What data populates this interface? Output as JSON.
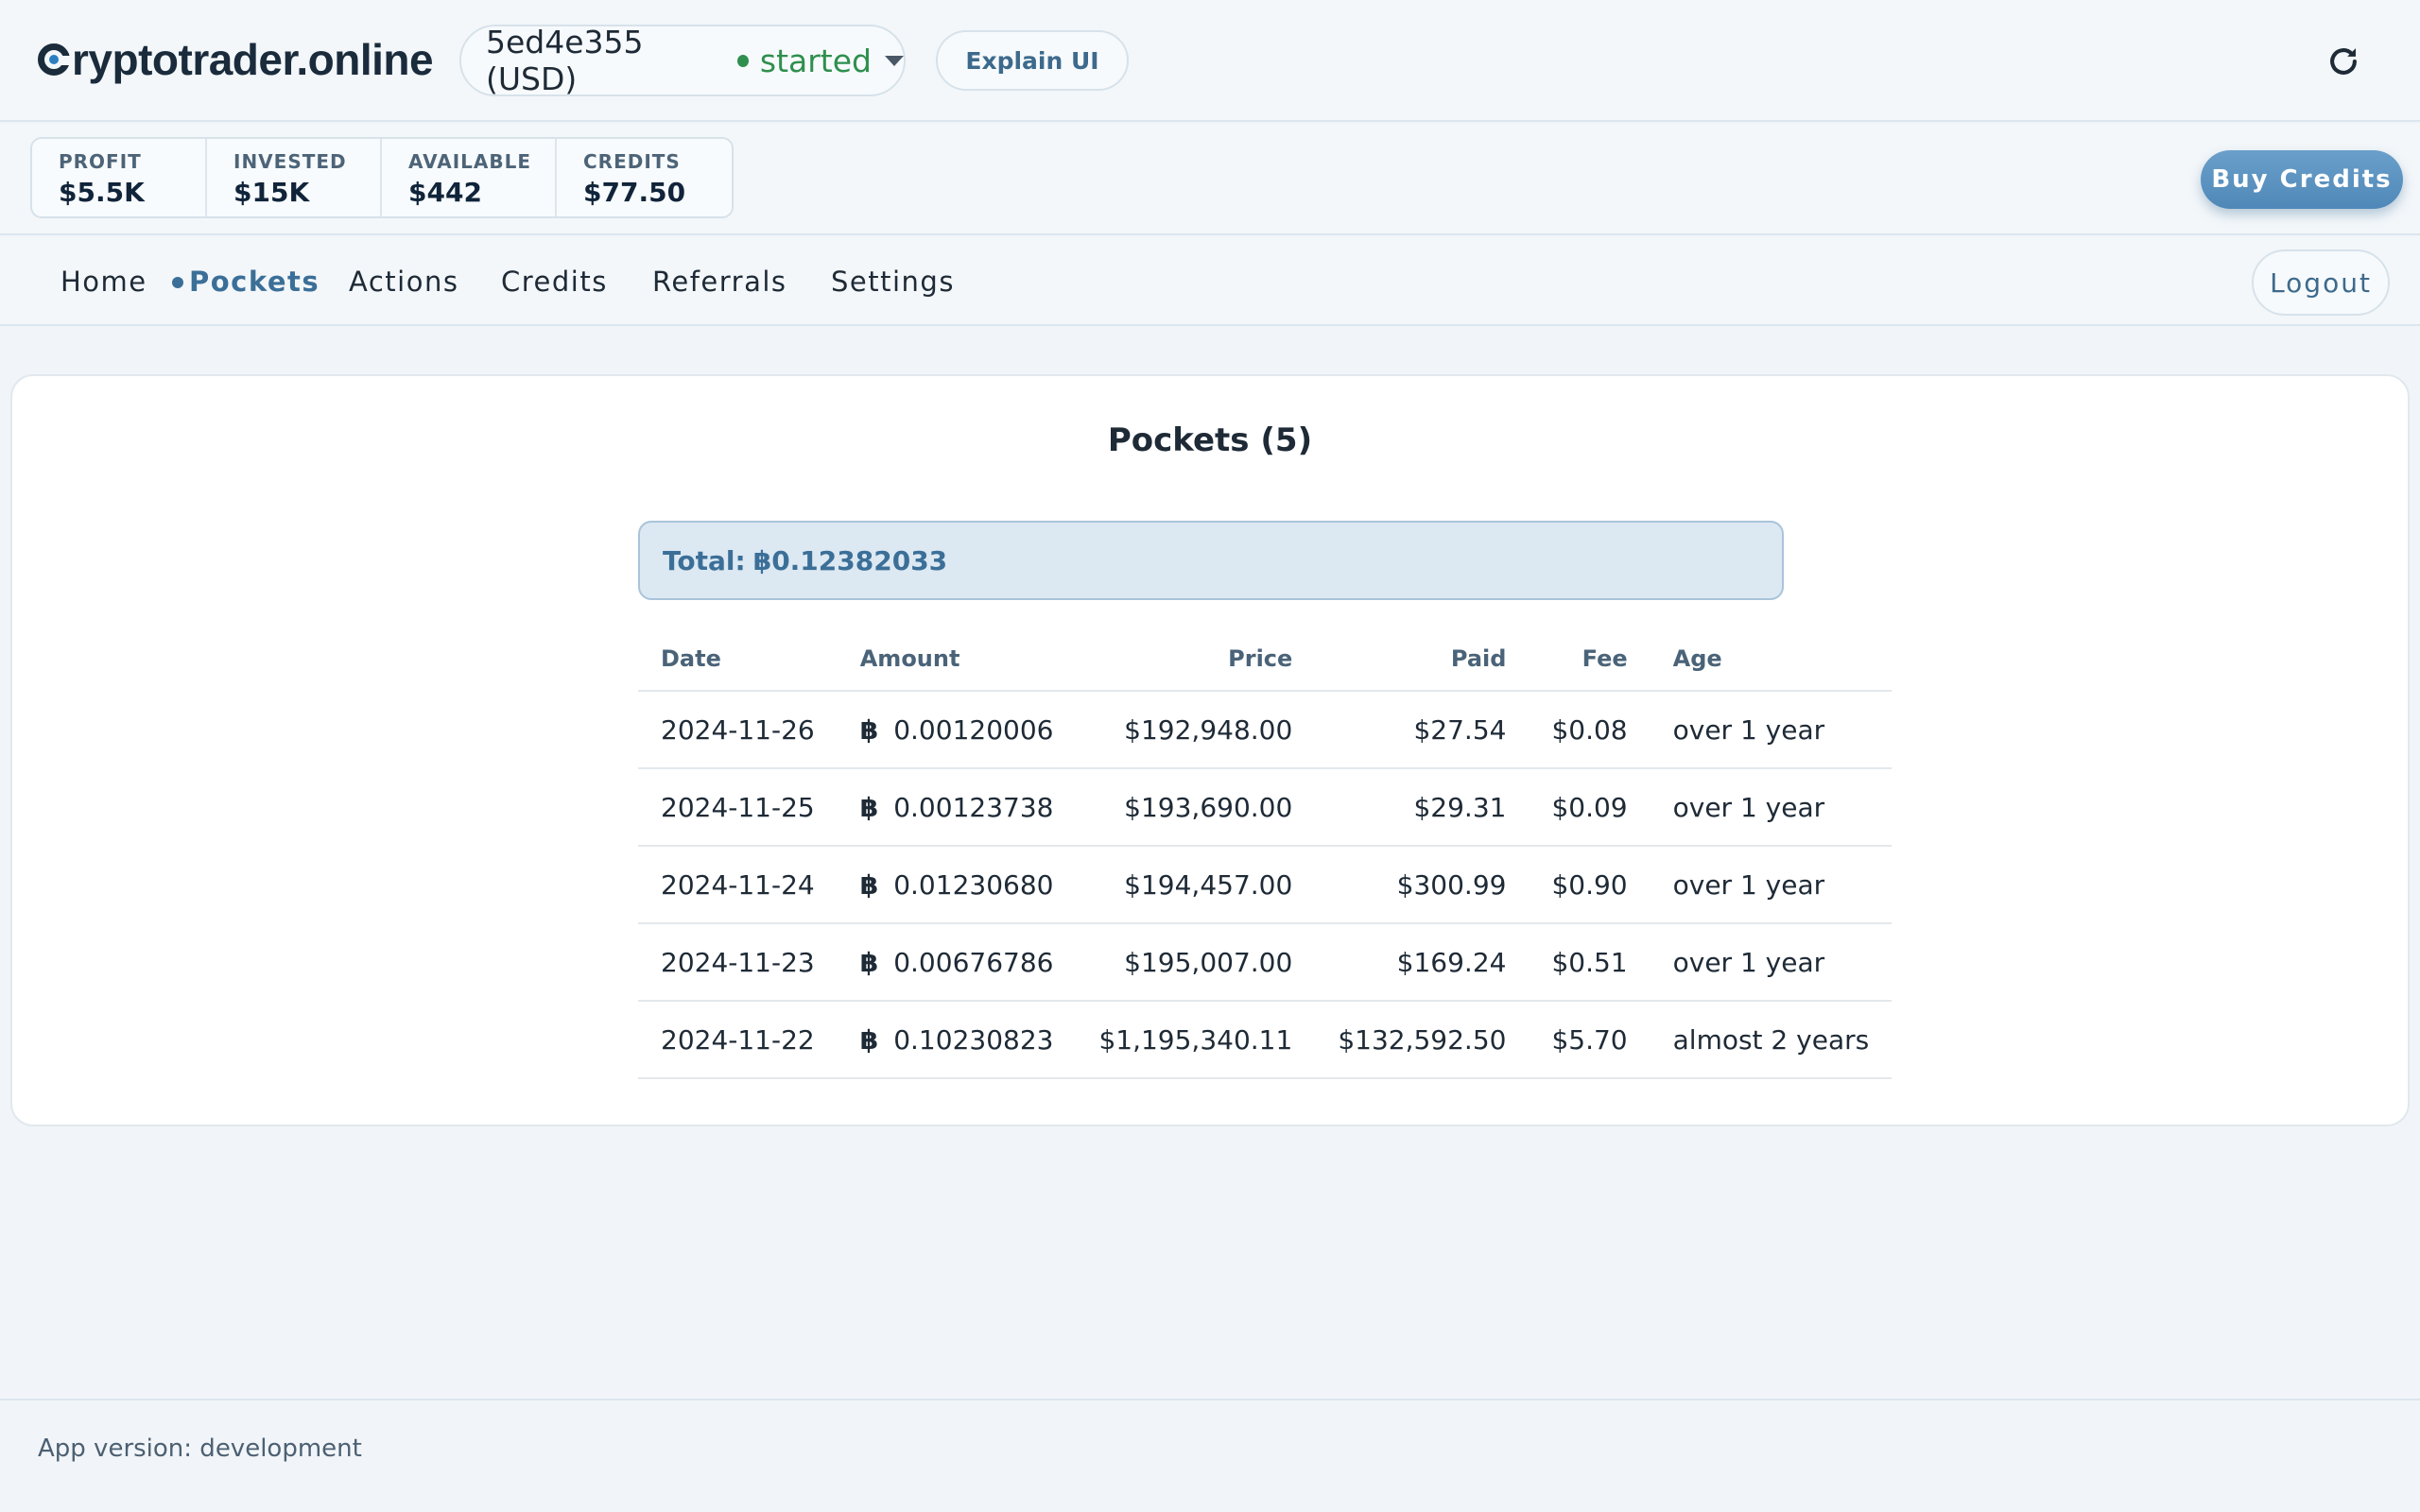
{
  "header": {
    "logo_text": "ryptotrader.online",
    "bot_id": "5ed4e355 (USD)",
    "bot_status": "started",
    "explain_label": "Explain UI",
    "status_color": "#2f8f4e"
  },
  "stats": [
    {
      "label": "PROFIT",
      "value": "$5.5K"
    },
    {
      "label": "INVESTED",
      "value": "$15K"
    },
    {
      "label": "AVAILABLE",
      "value": "$442"
    },
    {
      "label": "CREDITS",
      "value": "$77.50"
    }
  ],
  "buy_credits_label": "Buy Credits",
  "nav": {
    "items": [
      {
        "label": "Home"
      },
      {
        "label": "Pockets"
      },
      {
        "label": "Actions"
      },
      {
        "label": "Credits"
      },
      {
        "label": "Referrals"
      },
      {
        "label": "Settings"
      }
    ],
    "active": "Pockets",
    "logout_label": "Logout"
  },
  "pockets": {
    "title": "Pockets (5)",
    "total_label": "Total:",
    "total_symbol": "฿",
    "total_value": "0.12382033",
    "columns": [
      "Date",
      "Amount",
      "Price",
      "Paid",
      "Fee",
      "Age"
    ],
    "rows": [
      {
        "date": "2024-11-26",
        "symbol": "฿",
        "amount": "0.00120006",
        "price": "$192,948.00",
        "paid": "$27.54",
        "fee": "$0.08",
        "age": "over 1 year"
      },
      {
        "date": "2024-11-25",
        "symbol": "฿",
        "amount": "0.00123738",
        "price": "$193,690.00",
        "paid": "$29.31",
        "fee": "$0.09",
        "age": "over 1 year"
      },
      {
        "date": "2024-11-24",
        "symbol": "฿",
        "amount": "0.01230680",
        "price": "$194,457.00",
        "paid": "$300.99",
        "fee": "$0.90",
        "age": "over 1 year"
      },
      {
        "date": "2024-11-23",
        "symbol": "฿",
        "amount": "0.00676786",
        "price": "$195,007.00",
        "paid": "$169.24",
        "fee": "$0.51",
        "age": "over 1 year"
      },
      {
        "date": "2024-11-22",
        "symbol": "฿",
        "amount": "0.10230823",
        "price": "$1,195,340.11",
        "paid": "$132,592.50",
        "fee": "$5.70",
        "age": "almost 2 years"
      }
    ]
  },
  "footer": {
    "version_text": "App version: development"
  },
  "colors": {
    "accent": "#3b6f98",
    "background": "#f1f5f9",
    "buy_button": "#5a93c0"
  }
}
